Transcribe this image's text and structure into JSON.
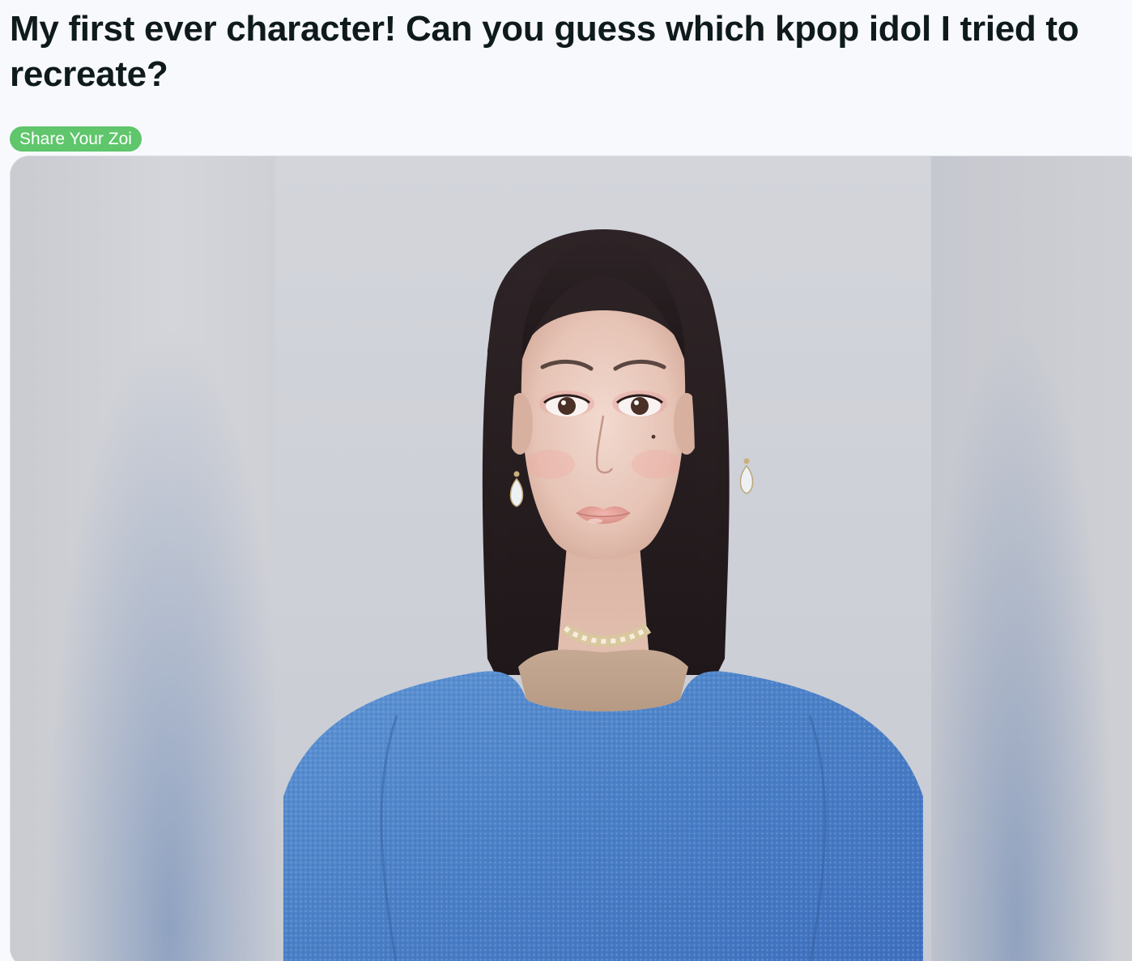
{
  "post": {
    "title": "My first ever character! Can you guess which kpop idol I tried to recreate?",
    "flair": {
      "label": "Share Your Zoi",
      "color": "#5fc66b"
    }
  },
  "media": {
    "type": "gallery-image",
    "next_button_icon": "chevron-right-icon"
  },
  "colors": {
    "page_background": "#f7f9fd",
    "title_text": "#0f1a1c",
    "sweater": "#4f86cc",
    "hair": "#2a1f22"
  }
}
